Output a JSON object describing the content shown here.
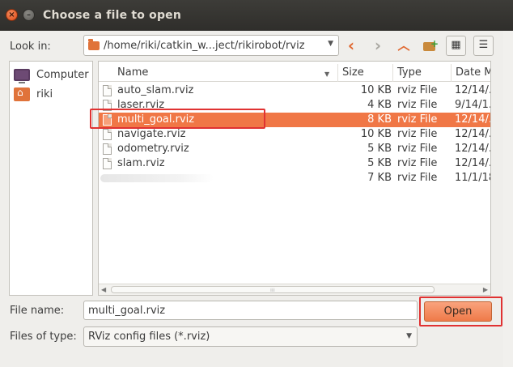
{
  "window": {
    "title": "Choose a file to open"
  },
  "toolbar": {
    "look_in_label": "Look in:",
    "path": "/home/riki/catkin_w...ject/rikirobot/rviz",
    "back_icon": "chevron-left-icon",
    "forward_icon": "chevron-right-icon",
    "up_icon": "chevron-up-icon",
    "new_folder_icon": "new-folder-icon",
    "grid_view_icon": "grid-view-icon",
    "list_view_icon": "list-view-icon"
  },
  "places": [
    {
      "label": "Computer",
      "icon": "computer-icon"
    },
    {
      "label": "riki",
      "icon": "home-folder-icon"
    }
  ],
  "columns": {
    "name": "Name",
    "size": "Size",
    "type": "Type",
    "date": "Date M"
  },
  "files": [
    {
      "name": "auto_slam.rviz",
      "size": "10 KB",
      "type": "rviz File",
      "date": "12/14/..."
    },
    {
      "name": "laser.rviz",
      "size": "4 KB",
      "type": "rviz File",
      "date": "9/14/1..."
    },
    {
      "name": "multi_goal.rviz",
      "size": "8 KB",
      "type": "rviz File",
      "date": "12/14/...",
      "selected": true
    },
    {
      "name": "navigate.rviz",
      "size": "10 KB",
      "type": "rviz File",
      "date": "12/14/..."
    },
    {
      "name": "odometry.rviz",
      "size": "5 KB",
      "type": "rviz File",
      "date": "12/14/..."
    },
    {
      "name": "slam.rviz",
      "size": "5 KB",
      "type": "rviz File",
      "date": "12/14/..."
    },
    {
      "name": "",
      "size": "7 KB",
      "type": "rviz File",
      "date": "11/1/18"
    }
  ],
  "footer": {
    "file_name_label": "File name:",
    "file_name_value": "multi_goal.rviz",
    "open_label": "Open",
    "files_of_type_label": "Files of type:",
    "files_of_type_value": "RViz config files (*.rviz)"
  },
  "colors": {
    "selection": "#f07746",
    "highlight_box": "#e03232",
    "accent": "#e0662e"
  }
}
